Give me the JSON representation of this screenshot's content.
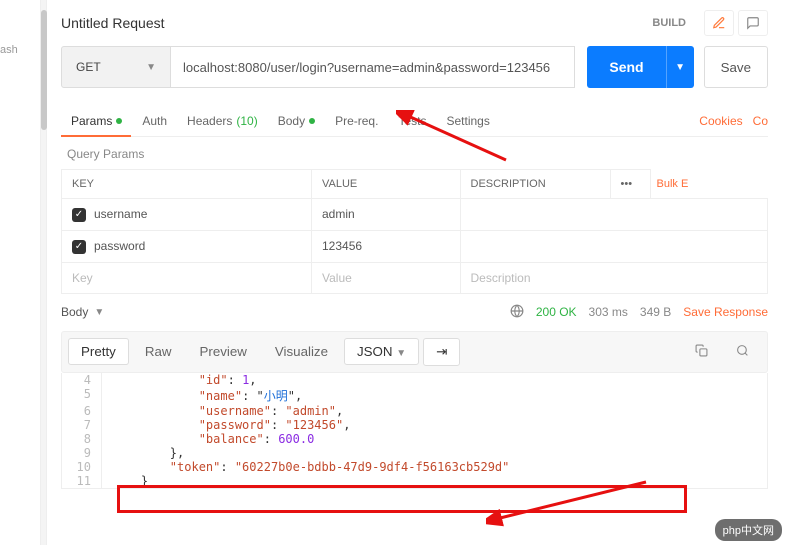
{
  "sidebar": {
    "hint": "ash"
  },
  "titleRow": {
    "title": "Untitled Request",
    "build": "BUILD"
  },
  "request": {
    "method": "GET",
    "url": "localhost:8080/user/login?username=admin&password=123456",
    "send": "Send",
    "save": "Save"
  },
  "tabs": {
    "params": "Params",
    "auth": "Auth",
    "headers": "Headers",
    "headersCount": "(10)",
    "body": "Body",
    "prereq": "Pre-req.",
    "tests": "Tests",
    "settings": "Settings",
    "cookies": "Cookies",
    "co": "Co"
  },
  "queryParams": {
    "title": "Query Params",
    "colKey": "KEY",
    "colValue": "VALUE",
    "colDesc": "DESCRIPTION",
    "bulk": "Bulk E",
    "rows": [
      {
        "key": "username",
        "value": "admin"
      },
      {
        "key": "password",
        "value": "123456"
      }
    ],
    "ph": {
      "key": "Key",
      "value": "Value",
      "desc": "Description"
    }
  },
  "response": {
    "bodyLabel": "Body",
    "status": "200 OK",
    "time": "303 ms",
    "size": "349 B",
    "saveResp": "Save Response",
    "views": {
      "pretty": "Pretty",
      "raw": "Raw",
      "preview": "Preview",
      "visualize": "Visualize",
      "format": "JSON"
    },
    "lines": [
      {
        "n": 4,
        "indent": 3,
        "key": "id",
        "numval": "1",
        "comma": ","
      },
      {
        "n": 5,
        "indent": 3,
        "key": "name",
        "zhval": "小明",
        "comma": ","
      },
      {
        "n": 6,
        "indent": 3,
        "key": "username",
        "strval": "admin",
        "comma": ","
      },
      {
        "n": 7,
        "indent": 3,
        "key": "password",
        "strval": "123456",
        "comma": ","
      },
      {
        "n": 8,
        "indent": 3,
        "key": "balance",
        "numval": "600.0"
      },
      {
        "n": 9,
        "indent": 2,
        "close": "},"
      },
      {
        "n": 10,
        "indent": 2,
        "key": "token",
        "strval": "60227b0e-bdbb-47d9-9df4-f56163cb529d"
      },
      {
        "n": 11,
        "indent": 1,
        "close": "}"
      }
    ]
  },
  "watermark": "php中文网"
}
